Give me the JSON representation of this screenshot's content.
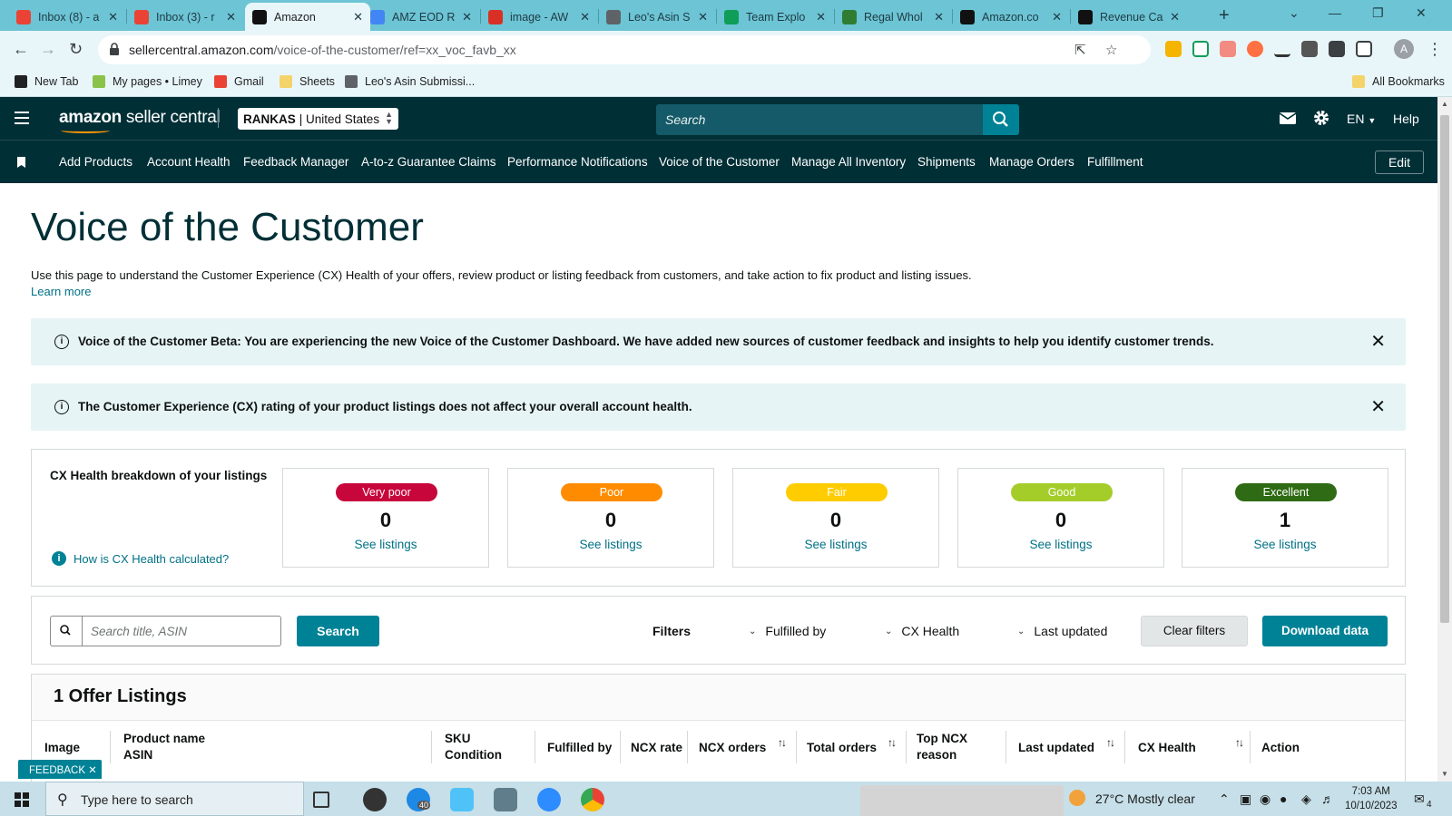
{
  "browser": {
    "tabs": [
      {
        "label": "Inbox (8) - a",
        "favicon": "gmail-icon",
        "color": "#ea4335",
        "active": false
      },
      {
        "label": "Inbox (3) - r",
        "favicon": "gmail-icon",
        "color": "#ea4335",
        "active": false
      },
      {
        "label": "Amazon",
        "favicon": "amazon-icon",
        "color": "#111111",
        "active": true
      },
      {
        "label": "AMZ EOD R",
        "favicon": "amz-eod-icon",
        "color": "#4285f4",
        "active": false
      },
      {
        "label": "image - AW",
        "favicon": "image-icon",
        "color": "#d93025",
        "active": false
      },
      {
        "label": "Leo's Asin S",
        "favicon": "leo-icon",
        "color": "#5f6368",
        "active": false
      },
      {
        "label": "Team Explo",
        "favicon": "sheets-plus-icon",
        "color": "#0f9d58",
        "active": false
      },
      {
        "label": "Regal Whol",
        "favicon": "regal-icon",
        "color": "#2e7d32",
        "active": false
      },
      {
        "label": "Amazon.co",
        "favicon": "amazon-icon",
        "color": "#111111",
        "active": false
      },
      {
        "label": "Revenue Ca",
        "favicon": "amazon-icon",
        "color": "#111111",
        "active": false
      }
    ],
    "new_tab": "+",
    "url_host": "sellercentral.amazon.com",
    "url_path": "/voice-of-the-customer/ref=xx_voc_favb_xx",
    "bookmarks": [
      {
        "label": "New Tab",
        "color": "#202124"
      },
      {
        "label": "My pages • Limey",
        "color": "#8bc34a"
      },
      {
        "label": "Gmail",
        "color": "#ea4335"
      },
      {
        "label": "Sheets",
        "color": "#f4d36b"
      },
      {
        "label": "Leo's Asin Submissi...",
        "color": "#5f6368"
      }
    ],
    "all_bookmarks": "All Bookmarks",
    "profile_initial": "A"
  },
  "header": {
    "logo_bold": "amazon",
    "logo_rest": " seller central",
    "account_name": "RANKAS",
    "account_region": "| United States",
    "search_placeholder": "Search",
    "language": "EN",
    "help": "Help"
  },
  "nav": {
    "links": [
      "Add Products",
      "Account Health",
      "Feedback Manager",
      "A-to-z Guarantee Claims",
      "Performance Notifications",
      "Voice of the Customer",
      "Manage All Inventory",
      "Shipments",
      "Manage Orders",
      "Fulfillment"
    ],
    "edit": "Edit"
  },
  "page": {
    "title": "Voice of the Customer",
    "intro": "Use this page to understand the Customer Experience (CX) Health of your offers, review product or listing feedback from customers, and take action to fix product and listing issues.",
    "learn_more": "Learn more",
    "banners": [
      {
        "text": "Voice of the Customer Beta: You are experiencing the new Voice of the Customer Dashboard. We have added new sources of customer feedback and insights to help you identify customer trends."
      },
      {
        "text": "The Customer Experience (CX) rating of your product listings does not affect your overall account health."
      }
    ]
  },
  "cx_health": {
    "title": "CX Health breakdown of your listings",
    "how_link": "How is CX Health calculated?",
    "cards": [
      {
        "label": "Very poor",
        "count": "0",
        "link": "See listings",
        "color": "#c7063c",
        "dark_text": false
      },
      {
        "label": "Poor",
        "count": "0",
        "link": "See listings",
        "color": "#ff8c00",
        "dark_text": false
      },
      {
        "label": "Fair",
        "count": "0",
        "link": "See listings",
        "color": "#ffcc00",
        "dark_text": false
      },
      {
        "label": "Good",
        "count": "0",
        "link": "See listings",
        "color": "#a4cd2a",
        "dark_text": false
      },
      {
        "label": "Excellent",
        "count": "1",
        "link": "See listings",
        "color": "#2f6b14",
        "dark_text": false
      }
    ]
  },
  "filters": {
    "search_placeholder": "Search title, ASIN",
    "search_button": "Search",
    "label": "Filters",
    "dropdowns": [
      "Fulfilled by",
      "CX Health",
      "Last updated"
    ],
    "clear": "Clear filters",
    "download": "Download data"
  },
  "offers": {
    "title": "1 Offer Listings",
    "columns": [
      {
        "line1": "Image",
        "line2": ""
      },
      {
        "line1": "Product name",
        "line2": "ASIN"
      },
      {
        "line1": "SKU",
        "line2": "Condition"
      },
      {
        "line1": "Fulfilled by",
        "line2": ""
      },
      {
        "line1": "NCX rate",
        "line2": ""
      },
      {
        "line1": "NCX orders",
        "line2": ""
      },
      {
        "line1": "Total orders",
        "line2": ""
      },
      {
        "line1": "Top NCX",
        "line2": "reason"
      },
      {
        "line1": "Last updated",
        "line2": ""
      },
      {
        "line1": "CX Health",
        "line2": ""
      },
      {
        "line1": "Action",
        "line2": ""
      }
    ]
  },
  "feedback_tab": "FEEDBACK ✕",
  "taskbar": {
    "search_text": "Type here to search",
    "weather": "27°C  Mostly clear",
    "time": "7:03 AM",
    "date": "10/10/2023",
    "notifications": "4",
    "app_badge": "40"
  }
}
